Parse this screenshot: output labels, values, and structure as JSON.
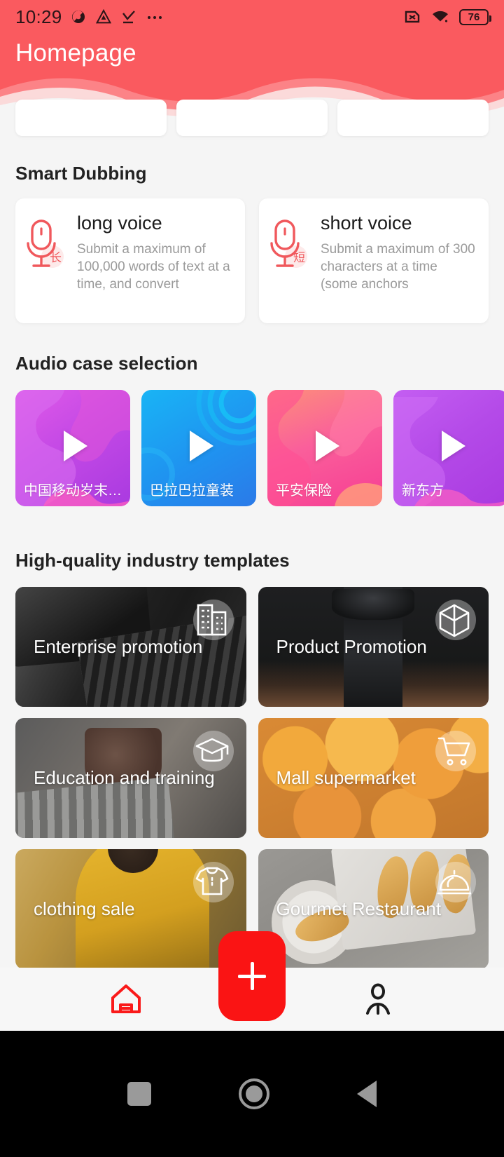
{
  "statusbar": {
    "time": "10:29",
    "battery_percent": "76",
    "icons": [
      "app-notification-icon",
      "warning-triangle-icon",
      "download-check-icon",
      "more-dots-icon"
    ],
    "right_icons": [
      "no-sim-icon",
      "wifi-icon",
      "battery-icon"
    ]
  },
  "header": {
    "title": "Homepage",
    "background_color": "#fa5a5f",
    "wave_color_light": "#fbdada",
    "wave_color_mid": "#fb8b8e"
  },
  "top_strip": {
    "cards": [
      {
        "name": "top-card-1"
      },
      {
        "name": "top-card-2"
      },
      {
        "name": "top-card-3"
      }
    ]
  },
  "smart_dubbing": {
    "heading": "Smart Dubbing",
    "cards": [
      {
        "title": "long voice",
        "description": "Submit a maximum of 100,000 words of text at a time, and convert",
        "badge": "长",
        "icon": "microphone-icon"
      },
      {
        "title": "short voice",
        "description": "Submit a maximum of 300 characters at a time (some anchors",
        "badge": "短",
        "icon": "microphone-icon"
      }
    ]
  },
  "audio_cases": {
    "heading": "Audio case selection",
    "items": [
      {
        "label": "中国移动岁末…",
        "theme": "purple-pink",
        "icon": "play-icon"
      },
      {
        "label": "巴拉巴拉童装",
        "theme": "blue",
        "icon": "play-icon"
      },
      {
        "label": "平安保险",
        "theme": "pink-orange",
        "icon": "play-icon"
      },
      {
        "label": "新东方",
        "theme": "violet",
        "icon": "play-icon"
      }
    ]
  },
  "templates": {
    "heading": "High-quality industry templates",
    "items": [
      {
        "label": "Enterprise promotion",
        "icon": "building-icon"
      },
      {
        "label": "Product Promotion",
        "icon": "cube-3d-icon"
      },
      {
        "label": "Education and training",
        "icon": "graduation-cap-icon"
      },
      {
        "label": "Mall supermarket",
        "icon": "shopping-cart-icon"
      },
      {
        "label": "clothing sale",
        "icon": "tshirt-icon"
      },
      {
        "label": "Gourmet Restaurant",
        "icon": "food-cloche-icon"
      }
    ]
  },
  "bottom_nav": {
    "items": [
      {
        "name": "home",
        "icon": "home-icon",
        "active": true
      },
      {
        "name": "profile",
        "icon": "person-icon",
        "active": false
      }
    ],
    "fab": {
      "icon": "plus-icon",
      "color": "#fa1414"
    }
  },
  "system_nav": {
    "buttons": [
      "recents-square-icon",
      "home-circle-icon",
      "back-triangle-icon"
    ]
  }
}
